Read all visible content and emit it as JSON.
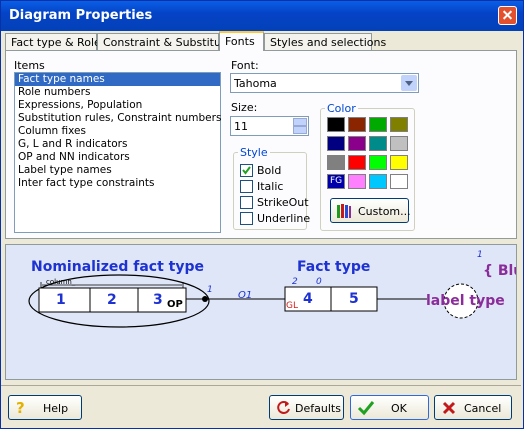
{
  "window": {
    "title": "Diagram Properties"
  },
  "tabs": [
    {
      "label": "Fact type & Role"
    },
    {
      "label": "Constraint & Substitution"
    },
    {
      "label": "Fonts"
    },
    {
      "label": "Styles and selections"
    }
  ],
  "items": {
    "label": "Items",
    "list": [
      "Fact type names",
      "Role numbers",
      "Expressions, Population",
      "Substitution rules, Constraint numbers",
      "Column fixes",
      "G, L and R indicators",
      "OP and NN indicators",
      "Label type names",
      "Inter fact type constraints"
    ],
    "selected": "Fact type names"
  },
  "font": {
    "label": "Font:",
    "value": "Tahoma"
  },
  "size": {
    "label": "Size:",
    "value": "11"
  },
  "style": {
    "label": "Style",
    "bold": {
      "label": "Bold",
      "checked": true
    },
    "italic": {
      "label": "Italic",
      "checked": false
    },
    "strikeout": {
      "label": "StrikeOut",
      "checked": false
    },
    "underline": {
      "label": "Underline",
      "checked": false
    }
  },
  "color": {
    "label": "Color",
    "swatches": [
      "#000000",
      "#8b2500",
      "#00aa00",
      "#808000",
      "#000080",
      "#8b008b",
      "#008b8b",
      "#c0c0c0",
      "#808080",
      "#ff0000",
      "#00ff00",
      "#ffff00",
      "#0000ff",
      "#ff80ff",
      "#00c8ff",
      "#ffffff"
    ],
    "fg_label": "FG",
    "custom_label": "Custom..."
  },
  "preview": {
    "nominalized_title": "Nominalized fact type",
    "column_label": "column_",
    "roles_left": [
      "1",
      "2",
      "3"
    ],
    "op": "OP",
    "role_num_1": "1",
    "o1": "O1",
    "fact_type_title": "Fact type",
    "role_num_2": "2",
    "role_num_0": "0",
    "gl": "GL",
    "roles_right": [
      "4",
      "5"
    ],
    "label_type": "label type",
    "top_num": "1",
    "bl_text": "{ Blu",
    "colors": {
      "blue": "#1e32d2",
      "purple": "#8b2c9b",
      "red": "#d21e1e"
    }
  },
  "buttons": {
    "help": "Help",
    "defaults": "Defaults",
    "ok": "OK",
    "cancel": "Cancel"
  }
}
